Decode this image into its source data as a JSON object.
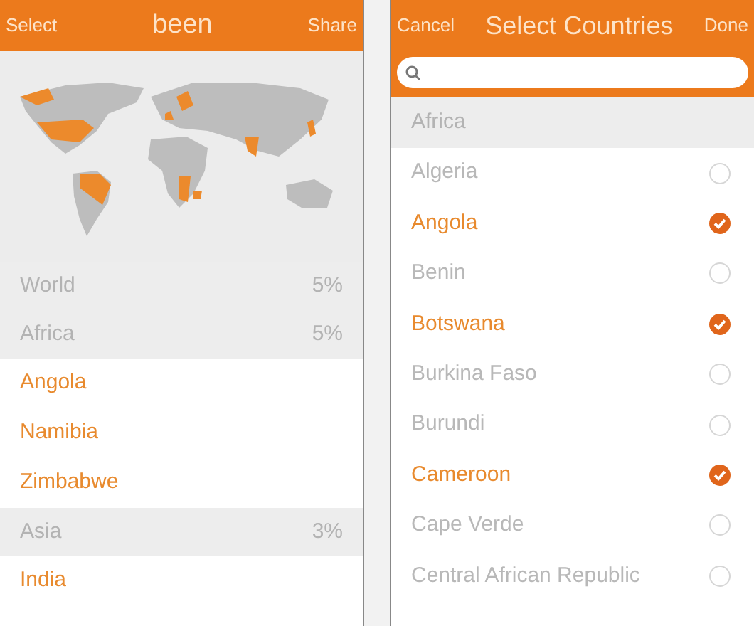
{
  "been_screen": {
    "header": {
      "left_button": "Select",
      "title": "been",
      "right_button": "Share"
    },
    "stats": [
      {
        "kind": "section",
        "name": "World",
        "percent": "5%"
      },
      {
        "kind": "section",
        "name": "Africa",
        "percent": "5%"
      },
      {
        "kind": "country",
        "name": "Angola"
      },
      {
        "kind": "country",
        "name": "Namibia"
      },
      {
        "kind": "country",
        "name": "Zimbabwe"
      },
      {
        "kind": "section",
        "name": "Asia",
        "percent": "3%"
      },
      {
        "kind": "country",
        "name": "India"
      }
    ]
  },
  "select_screen": {
    "header": {
      "left_button": "Cancel",
      "title": "Select Countries",
      "right_button": "Done"
    },
    "list": [
      {
        "kind": "section",
        "name": "Africa"
      },
      {
        "kind": "country",
        "name": "Algeria",
        "selected": false
      },
      {
        "kind": "country",
        "name": "Angola",
        "selected": true
      },
      {
        "kind": "country",
        "name": "Benin",
        "selected": false
      },
      {
        "kind": "country",
        "name": "Botswana",
        "selected": true
      },
      {
        "kind": "country",
        "name": "Burkina Faso",
        "selected": false
      },
      {
        "kind": "country",
        "name": "Burundi",
        "selected": false
      },
      {
        "kind": "country",
        "name": "Cameroon",
        "selected": true
      },
      {
        "kind": "country",
        "name": "Cape Verde",
        "selected": false
      },
      {
        "kind": "country",
        "name": "Central African Republic",
        "selected": false
      }
    ]
  }
}
